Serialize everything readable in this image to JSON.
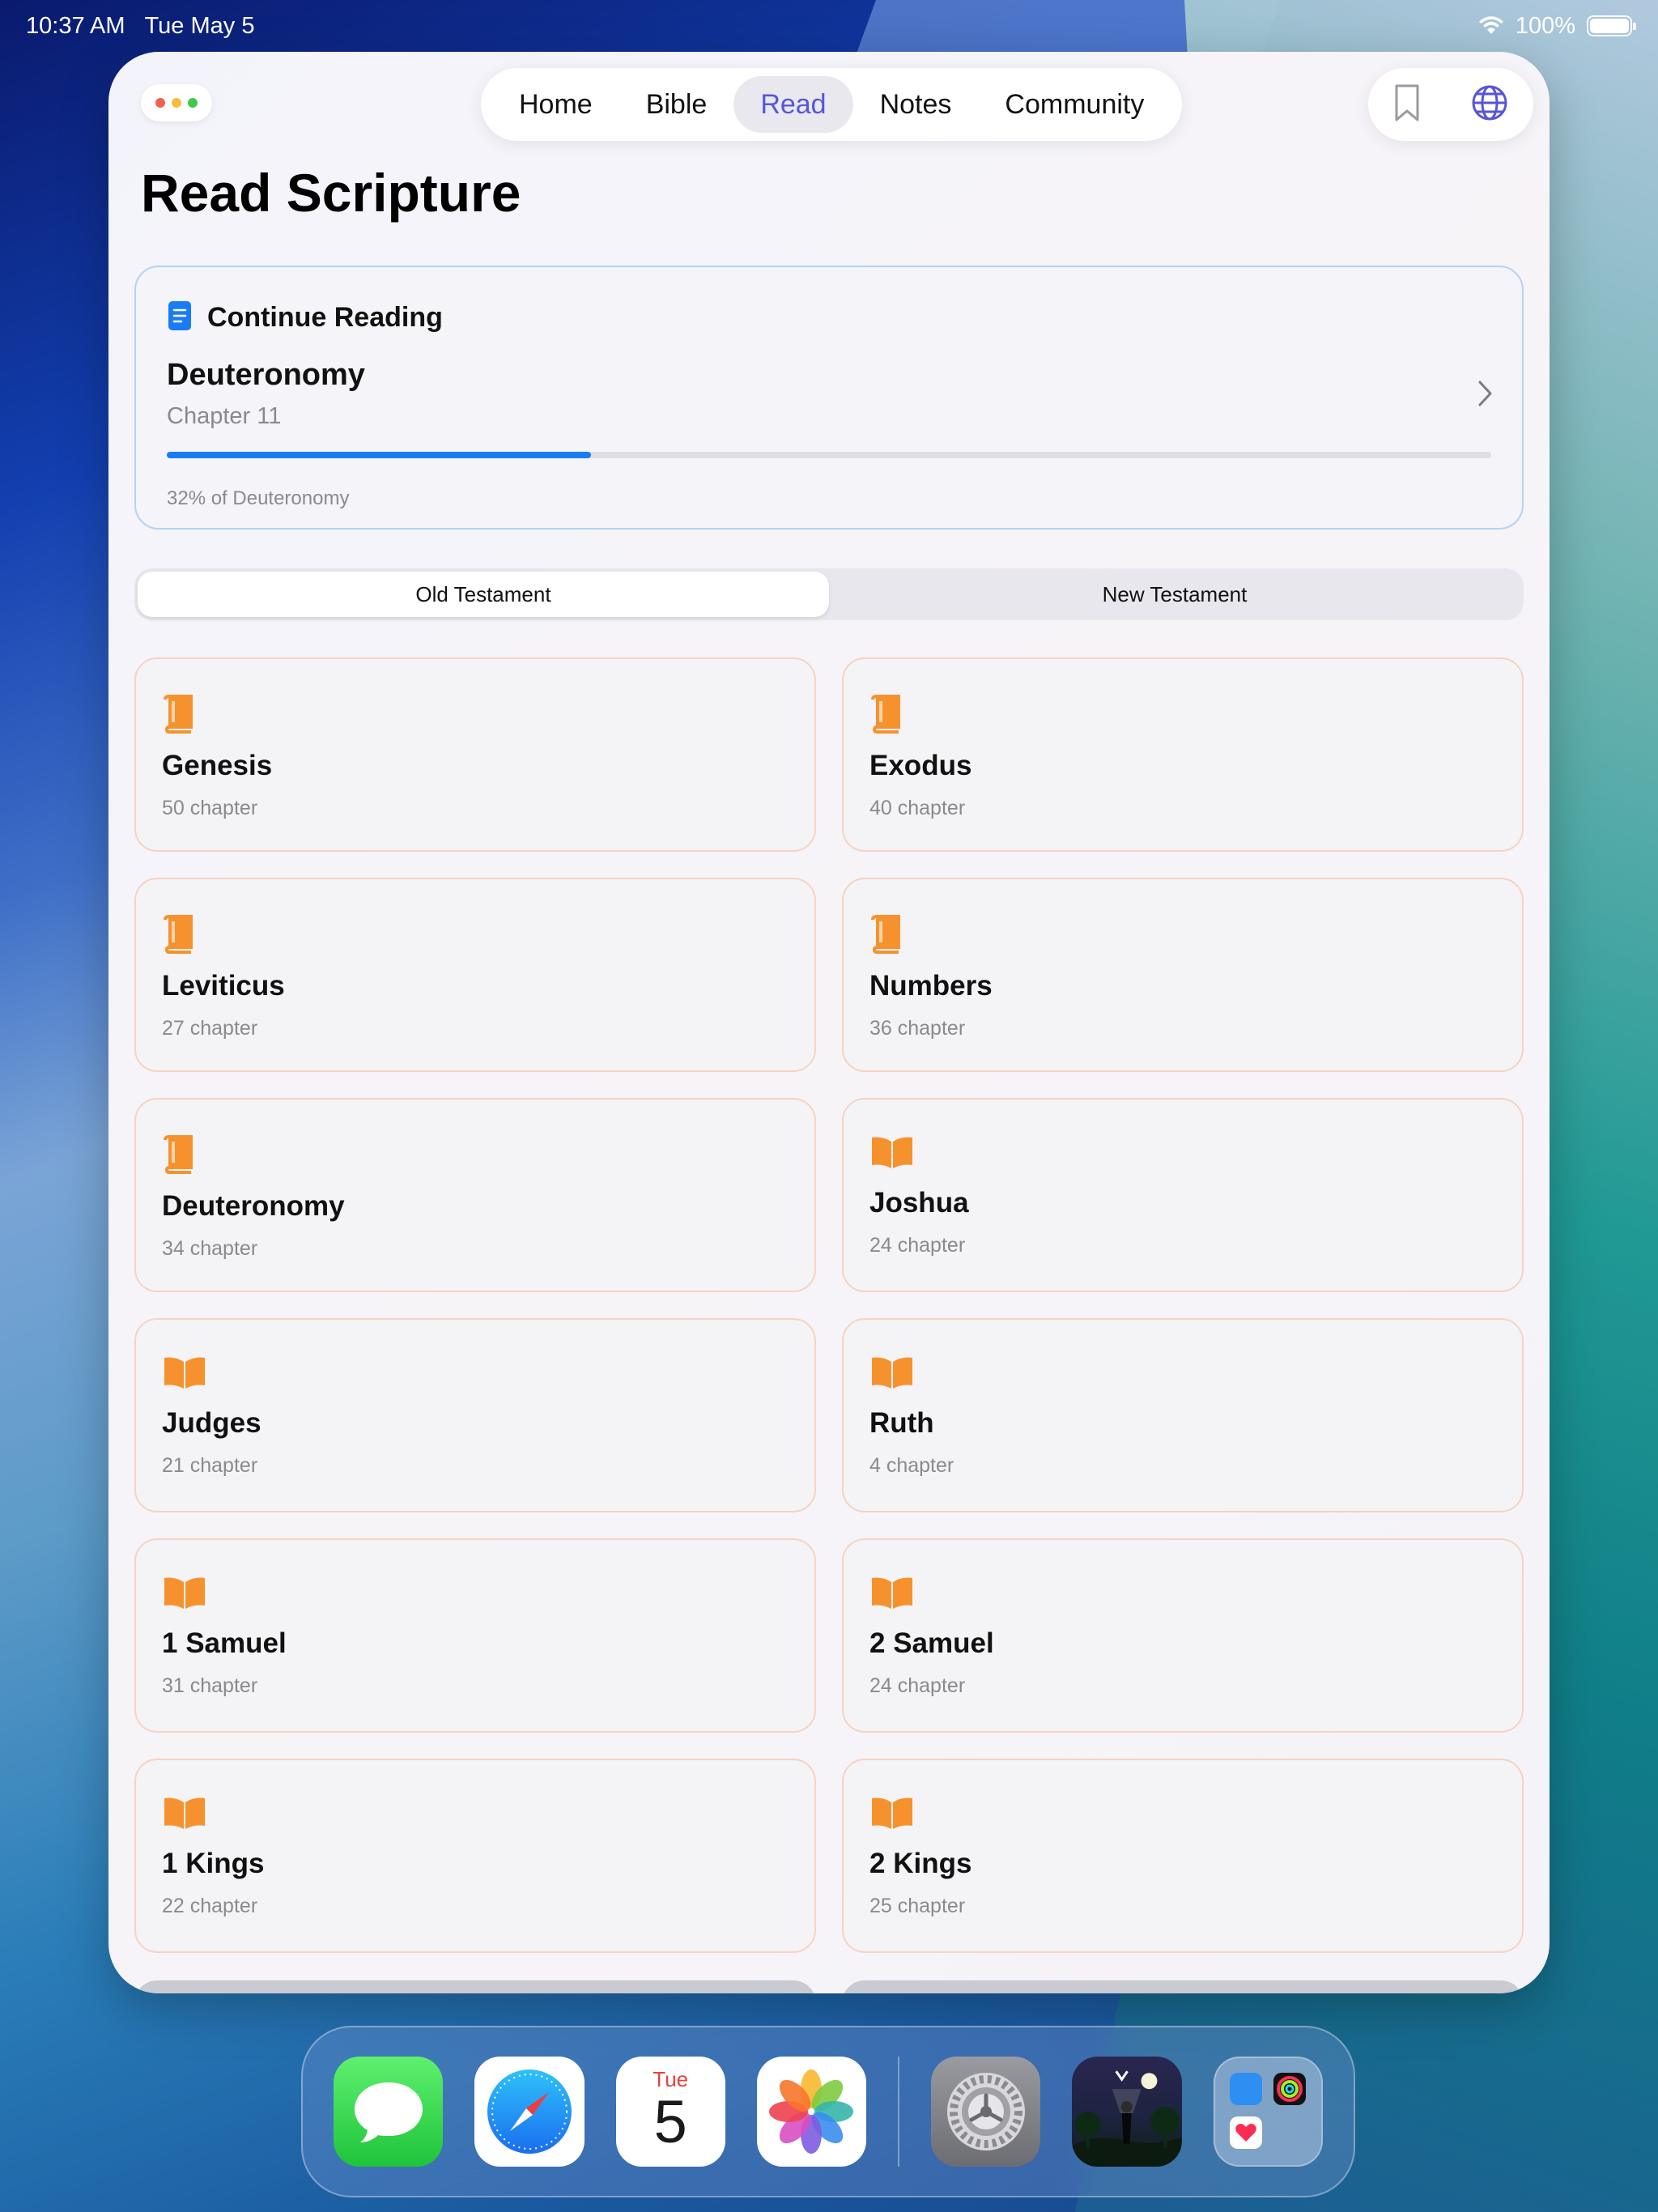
{
  "status_bar": {
    "time": "10:37 AM",
    "date": "Tue May 5",
    "battery": "100%"
  },
  "nav": {
    "tabs": [
      {
        "label": "Home"
      },
      {
        "label": "Bible"
      },
      {
        "label": "Read"
      },
      {
        "label": "Notes"
      },
      {
        "label": "Community"
      }
    ],
    "active": "Read"
  },
  "page_title": "Read Scripture",
  "continue_reading": {
    "heading": "Continue Reading",
    "book": "Deuteronomy",
    "chapter": "Chapter 11",
    "progress": 0.32,
    "progress_text": "32% of Deuteronomy"
  },
  "segments": {
    "old": "Old Testament",
    "new": "New Testament",
    "active": "Old Testament"
  },
  "books": [
    {
      "name": "Genesis",
      "count": "50 chapter",
      "icon": "closed-book-icon"
    },
    {
      "name": "Exodus",
      "count": "40 chapter",
      "icon": "closed-book-icon"
    },
    {
      "name": "Leviticus",
      "count": "27 chapter",
      "icon": "closed-book-icon"
    },
    {
      "name": "Numbers",
      "count": "36 chapter",
      "icon": "closed-book-icon"
    },
    {
      "name": "Deuteronomy",
      "count": "34 chapter",
      "icon": "closed-book-icon"
    },
    {
      "name": "Joshua",
      "count": "24 chapter",
      "icon": "open-book-icon"
    },
    {
      "name": "Judges",
      "count": "21 chapter",
      "icon": "open-book-icon"
    },
    {
      "name": "Ruth",
      "count": "4 chapter",
      "icon": "open-book-icon"
    },
    {
      "name": "1 Samuel",
      "count": "31 chapter",
      "icon": "open-book-icon"
    },
    {
      "name": "2 Samuel",
      "count": "24 chapter",
      "icon": "open-book-icon"
    },
    {
      "name": "1 Kings",
      "count": "22 chapter",
      "icon": "open-book-icon"
    },
    {
      "name": "2 Kings",
      "count": "25 chapter",
      "icon": "open-book-icon"
    }
  ],
  "dock": {
    "apps": [
      "messages",
      "safari",
      "calendar",
      "photos",
      "settings",
      "game",
      "folder"
    ],
    "calendar_day": "Tue",
    "calendar_date": "5"
  },
  "colors": {
    "accent": "#5856d6",
    "progress": "#1a7cf5",
    "book_icon": "#f6922e",
    "card_border": "#f6d3c2"
  }
}
